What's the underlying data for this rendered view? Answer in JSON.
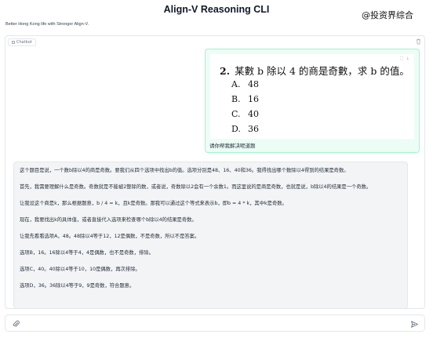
{
  "header": {
    "title": "Align-V Reasoning CLI",
    "watermark": "@投资界综合",
    "subtitle": "Better Hong Kong life with Stronger Align-V."
  },
  "chat": {
    "tag_label": "Chatbot",
    "user_message": {
      "question_number": "2.",
      "question_text": "某數 b 除以 4 的商是奇數，求 b 的值。",
      "options": [
        {
          "label": "A.",
          "value": "48"
        },
        {
          "label": "B.",
          "value": "16"
        },
        {
          "label": "C.",
          "value": "40"
        },
        {
          "label": "D.",
          "value": "36"
        }
      ],
      "text": "请你帮我解决呢道题"
    },
    "bot_message": {
      "paragraphs": [
        "这个题目是说，一个数b除以4的商是奇数。要我们从四个选项中找出b的值。选项分别是48、16、40和36。我得找出哪个数除以4得到的结果是奇数。",
        "首先，我需要理解什么是奇数。奇数就是不能被2整除的数，或者说，奇数除以2会有一个余数1。而这里说的是商是奇数，也就是说，b除以4的结果是一个奇数。",
        "让我设这个商是k，那么根据题意，b / 4 = k，且k是奇数。那我可以通过这个等式来表示b，即b = 4 * k，其中k是奇数。",
        "现在，我要找出k的具体值，或者直接代入选项来检查哪个b除以4的结果是奇数。",
        "让我先看看选项A，48。48除以4等于12，12是偶数，不是奇数，所以不是答案。",
        "选项B，16。16除以4等于4，4是偶数，也不是奇数，排除。",
        "选项C，40。40除以4等于10，10是偶数，再次排除。",
        "选项D，36。36除以4等于9，9是奇数，符合题意。"
      ]
    }
  },
  "input": {
    "placeholder": ""
  }
}
